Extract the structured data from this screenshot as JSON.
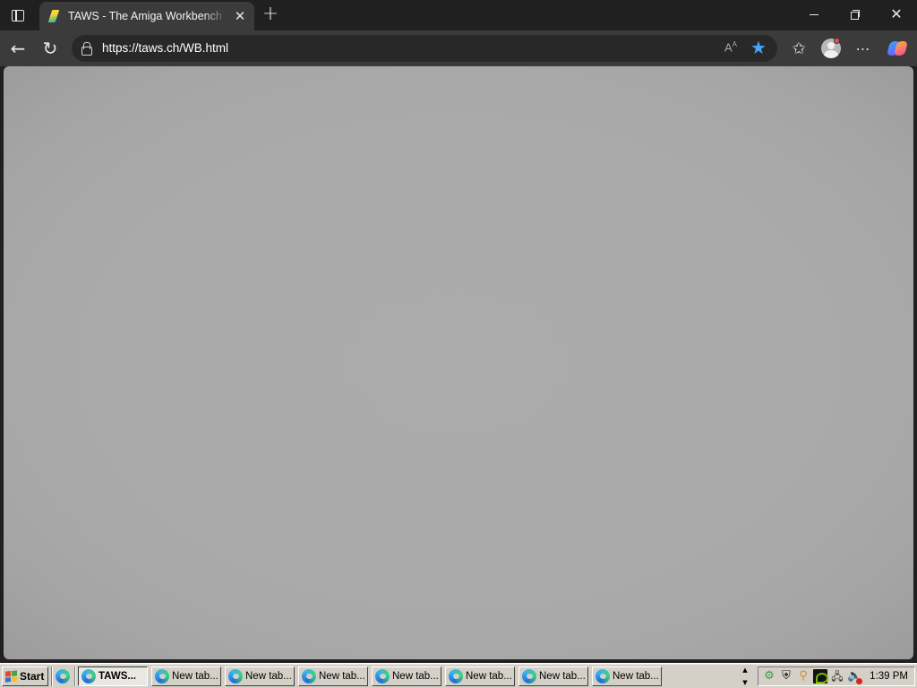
{
  "browser": {
    "tab": {
      "title": "TAWS - The Amiga Workbench Simulation",
      "close_glyph": "✕"
    },
    "new_tab_glyph": "+",
    "window_controls": {
      "close_glyph": "✕"
    },
    "toolbar": {
      "back_glyph": "←",
      "reload_glyph": "↻",
      "url": "https://taws.ch/WB.html",
      "read_aloud_label": "A",
      "read_aloud_sup": "A",
      "favorite_glyph": "★",
      "favorites_glyph": "✩",
      "more_glyph": "⋯"
    }
  },
  "taskbar": {
    "start_label": "Start",
    "tasks": [
      {
        "label": "TAWS...",
        "active": true
      },
      {
        "label": "New tab...",
        "active": false
      },
      {
        "label": "New tab...",
        "active": false
      },
      {
        "label": "New tab...",
        "active": false
      },
      {
        "label": "New tab...",
        "active": false
      },
      {
        "label": "New tab...",
        "active": false
      },
      {
        "label": "New tab...",
        "active": false
      },
      {
        "label": "New tab...",
        "active": false
      }
    ],
    "clock": "1:39 PM"
  },
  "icons": {
    "tray": [
      "gear-icon",
      "shield-icon",
      "search-icon",
      "nvidia-icon",
      "network-icon",
      "volume-muted-icon"
    ]
  },
  "colors": {
    "titlebar": "#202020",
    "toolbar": "#3b3b3b",
    "omnibox": "#282828",
    "favorite_star": "#4aa3ff",
    "content": "#aaaaaa",
    "taskbar": "#d4d0c8"
  }
}
